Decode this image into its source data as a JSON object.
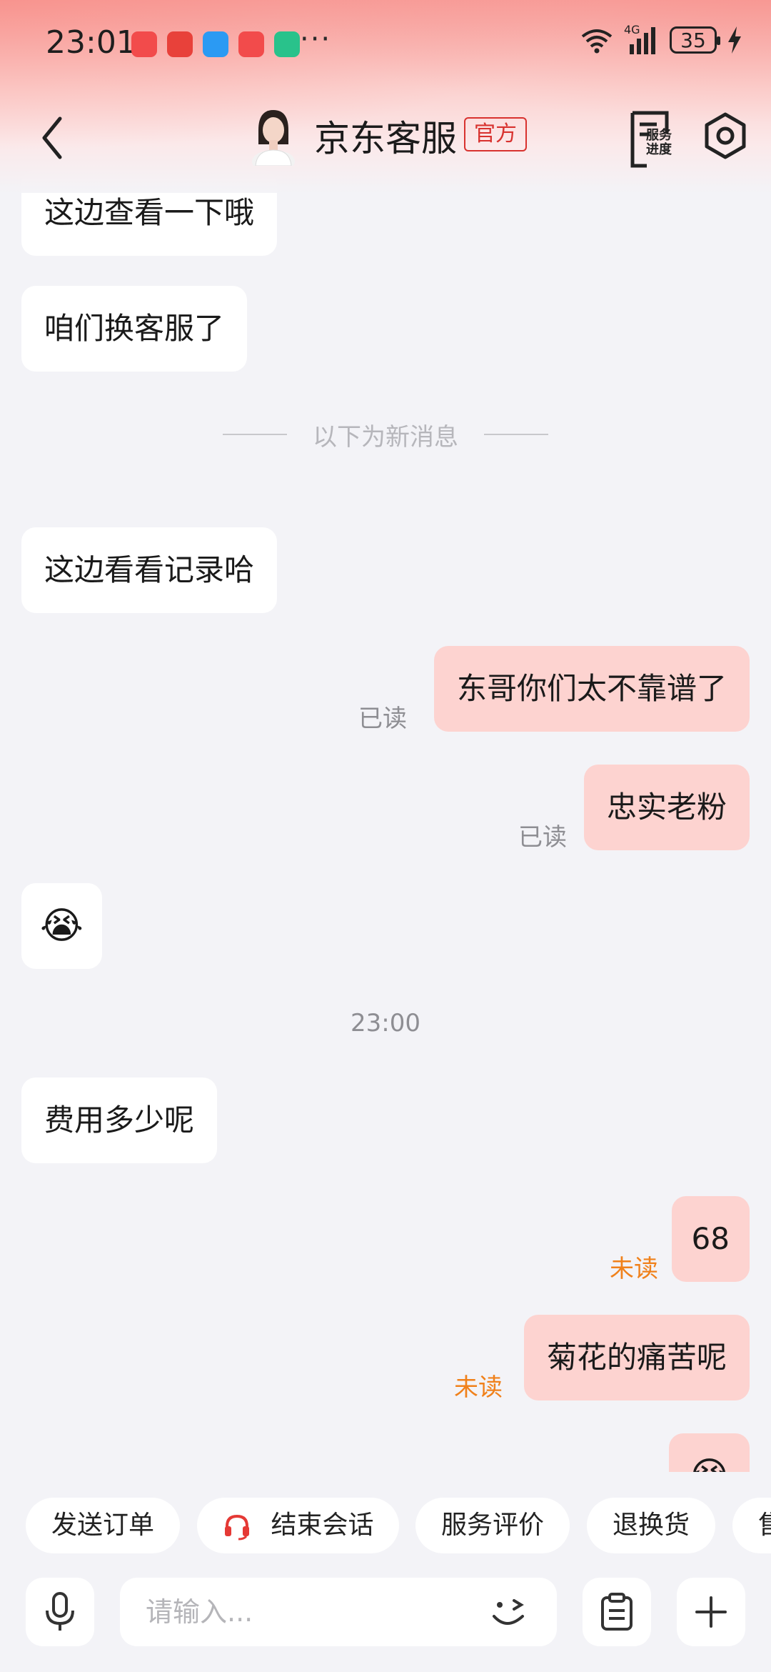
{
  "status_bar": {
    "time": "23:01",
    "more": "···",
    "network": "4G",
    "battery": "35",
    "app_icons": [
      {
        "name": "huawei-appgallery-icon",
        "color": "#f24b4b"
      },
      {
        "name": "jd-618-icon",
        "color": "#e8413a"
      },
      {
        "name": "messages-icon",
        "color": "#2b9af3"
      },
      {
        "name": "huawei-store-icon",
        "color": "#f24b4b"
      },
      {
        "name": "security-shield-icon",
        "color": "#29c28b"
      }
    ]
  },
  "header": {
    "title": "京东客服",
    "badge": "官方",
    "service_progress_label_1": "服务",
    "service_progress_label_2": "进度"
  },
  "messages": {
    "m1": "这边查看一下哦",
    "m2": "咱们换客服了",
    "new_divider": "以下为新消息",
    "m3": "这边看看记录哈",
    "m4": "东哥你们太不靠谱了",
    "m4_status": "已读",
    "m5": "忠实老粉",
    "m5_status": "已读",
    "m6": "😭",
    "time_sep": "23:00",
    "m7": "费用多少呢",
    "m8": "68",
    "m8_status": "未读",
    "m9": "菊花的痛苦呢",
    "m9_status": "未读",
    "m10": "😭"
  },
  "quick_actions": [
    "发送订单",
    "结束会话",
    "服务评价",
    "退换货",
    "售"
  ],
  "input": {
    "placeholder": "请输入..."
  },
  "colors": {
    "accent_red": "#d8322f",
    "bubble_out": "#fdd3d0",
    "unread_orange": "#f0811b"
  }
}
